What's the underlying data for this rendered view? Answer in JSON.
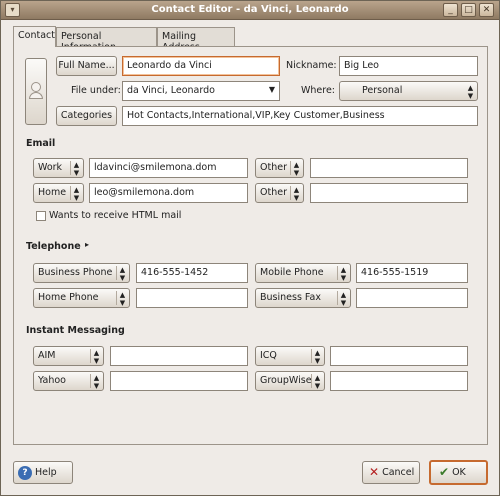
{
  "window": {
    "title": "Contact Editor - da Vinci, Leonardo",
    "buttons": [
      "_",
      "□",
      "✕"
    ]
  },
  "tabs": [
    {
      "label": "Contact",
      "active": true
    },
    {
      "label": "Personal Information",
      "active": false
    },
    {
      "label": "Mailing Address",
      "active": false
    }
  ],
  "identity": {
    "full_name_button": "Full Name...",
    "full_name_value": "Leonardo da Vinci",
    "nickname_label": "Nickname:",
    "nickname_value": "Big Leo",
    "file_under_label": "File under:",
    "file_under_value": "da Vinci, Leonardo",
    "where_label": "Where:",
    "where_value": "Personal",
    "categories_button": "Categories",
    "categories_value": "Hot Contacts,International,VIP,Key Customer,Business"
  },
  "email": {
    "heading": "Email",
    "rows": [
      {
        "type": "Work",
        "value": "ldavinci@smilemona.dom",
        "type2": "Other",
        "value2": ""
      },
      {
        "type": "Home",
        "value": "leo@smilemona.dom",
        "type2": "Other",
        "value2": ""
      }
    ],
    "html_mail_label": "Wants to receive HTML mail"
  },
  "telephone": {
    "heading": "Telephone",
    "rows": [
      {
        "type": "Business Phone",
        "value": "416-555-1452",
        "type2": "Mobile Phone",
        "value2": "416-555-1519"
      },
      {
        "type": "Home Phone",
        "value": "",
        "type2": "Business Fax",
        "value2": ""
      }
    ]
  },
  "im": {
    "heading": "Instant Messaging",
    "rows": [
      {
        "type": "AIM",
        "value": "",
        "type2": "ICQ",
        "value2": ""
      },
      {
        "type": "Yahoo",
        "value": "",
        "type2": "GroupWise",
        "value2": ""
      }
    ]
  },
  "footer": {
    "help": "Help",
    "cancel": "Cancel",
    "ok": "OK"
  }
}
